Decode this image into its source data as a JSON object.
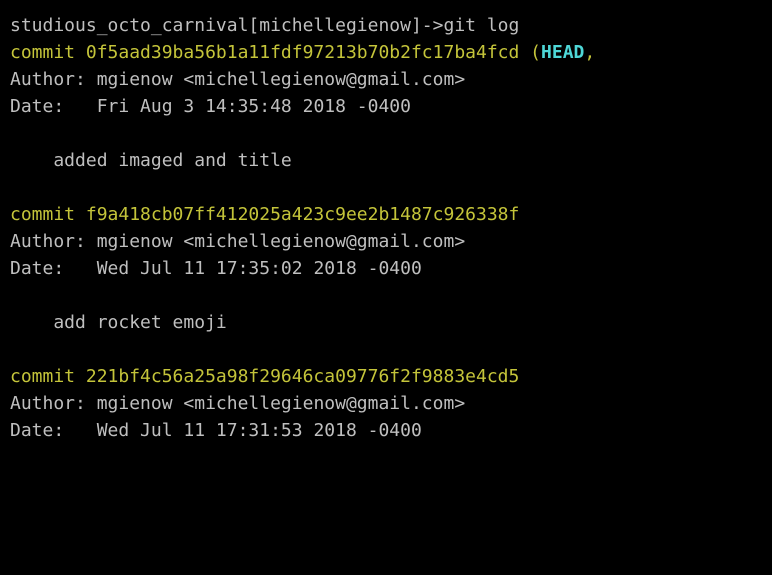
{
  "prompt": {
    "path": "studious_octo_carnival[michellegienow]->",
    "command": "git log"
  },
  "commits": [
    {
      "hash_line_prefix": "commit ",
      "hash": "0f5aad39ba56b1a11fdf97213b70b2fc17ba4fcd",
      "ref_open": " (",
      "ref_head": "HEAD",
      "ref_trail": ",",
      "author_label": "Author: ",
      "author": "mgienow <michellegienow@gmail.com>",
      "date_label": "Date:   ",
      "date": "Fri Aug 3 14:35:48 2018 -0400",
      "message": "    added imaged and title"
    },
    {
      "hash_line_prefix": "commit ",
      "hash": "f9a418cb07ff412025a423c9ee2b1487c926338f",
      "author_label": "Author: ",
      "author": "mgienow <michellegienow@gmail.com>",
      "date_label": "Date:   ",
      "date": "Wed Jul 11 17:35:02 2018 -0400",
      "message": "    add rocket emoji"
    },
    {
      "hash_line_prefix": "commit ",
      "hash": "221bf4c56a25a98f29646ca09776f2f9883e4cd5",
      "author_label": "Author: ",
      "author": "mgienow <michellegienow@gmail.com>",
      "date_label": "Date:   ",
      "date": "Wed Jul 11 17:31:53 2018 -0400"
    }
  ]
}
